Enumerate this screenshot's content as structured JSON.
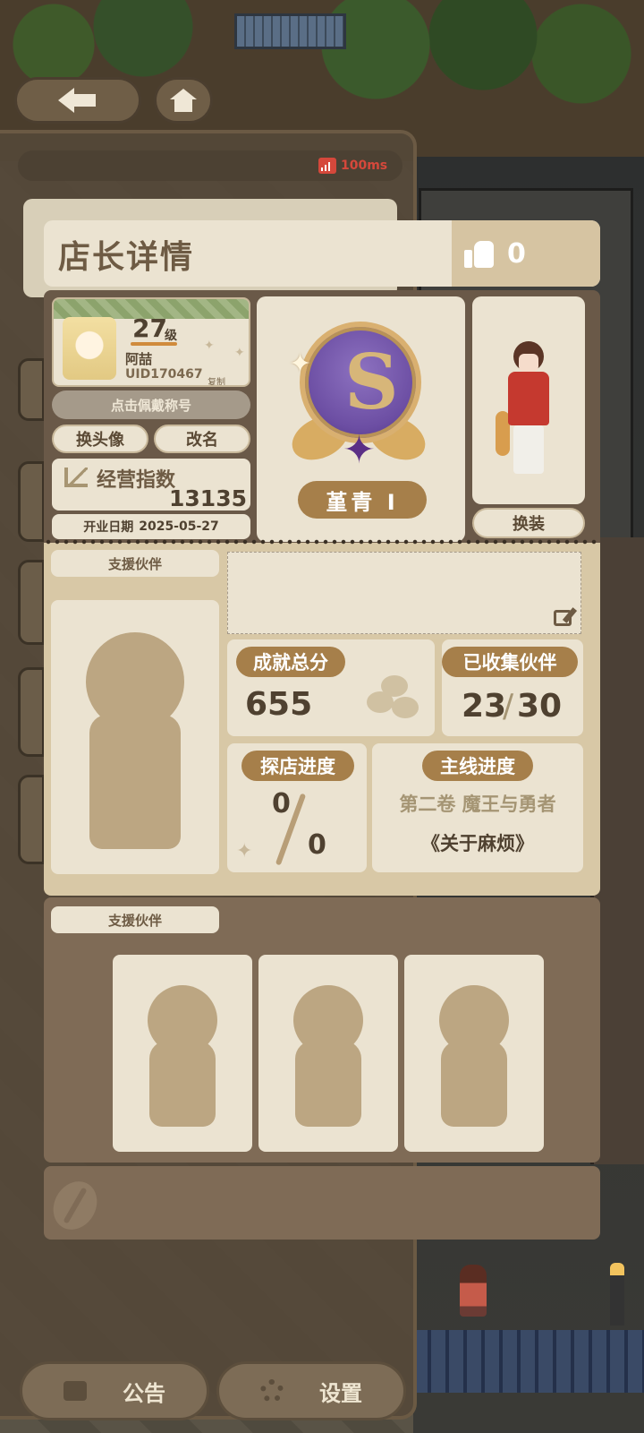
{
  "status": {
    "ping": "100ms"
  },
  "modal": {
    "title": "店长详情",
    "likes": "0",
    "profile": {
      "level": "27",
      "level_unit": "级",
      "nickname": "阿喆",
      "uid": "UID170467",
      "copy_label": "复制"
    },
    "wear_title_button": "点击佩戴称号",
    "change_avatar_button": "换头像",
    "rename_button": "改名",
    "business_index_label": "经营指数",
    "business_index_value": "13135",
    "open_date_label": "开业日期",
    "open_date_value": "2025-05-27",
    "rank_name": "堇青 I",
    "change_outfit_button": "换装",
    "support_partner_label": "支援伙伴",
    "achievement": {
      "label": "成就总分",
      "value": "655"
    },
    "collected": {
      "label": "已收集伙伴",
      "current": "23",
      "separator": "/",
      "total": "30"
    },
    "explore": {
      "label": "探店进度",
      "current": "0",
      "total": "0"
    },
    "story": {
      "label": "主线进度",
      "chapter": "第二卷 魔王与勇者",
      "title": "《关于麻烦》"
    },
    "support_partners_label": "支援伙伴"
  },
  "bottom": {
    "notice_button": "公告",
    "settings_button": "设置"
  },
  "colors": {
    "accent": "#a67f4a",
    "panel": "#ebe3d1",
    "rank_badge": "#6c4ea3",
    "ping_red": "#d5483b"
  },
  "icons": [
    "back-arrow-icon",
    "home-icon",
    "signal-icon",
    "thumbs-up-icon",
    "chart-icon",
    "edit-icon",
    "coffee-bean-icon",
    "notice-icon",
    "gear-icon"
  ]
}
